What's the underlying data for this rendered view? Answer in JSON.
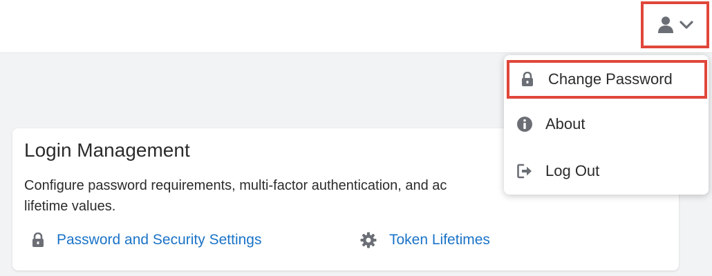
{
  "header": {
    "user_menu": {
      "icon": "user-icon",
      "caret_icon": "chevron-down-icon",
      "highlight_color": "#e0473a"
    }
  },
  "dropdown": {
    "items": [
      {
        "label": "Change Password",
        "icon": "lock-icon",
        "highlighted": true
      },
      {
        "label": "About",
        "icon": "info-icon",
        "highlighted": false
      },
      {
        "label": "Log Out",
        "icon": "logout-icon",
        "highlighted": false
      }
    ]
  },
  "card": {
    "title": "Login Management",
    "description": "Configure password requirements, multi-factor authentication, and ac",
    "description_line2": "lifetime values.",
    "links": [
      {
        "label": "Password and Security Settings",
        "icon": "lock-icon"
      },
      {
        "label": "Token Lifetimes",
        "icon": "gear-icon"
      }
    ],
    "link_color": "#1a73c7"
  }
}
